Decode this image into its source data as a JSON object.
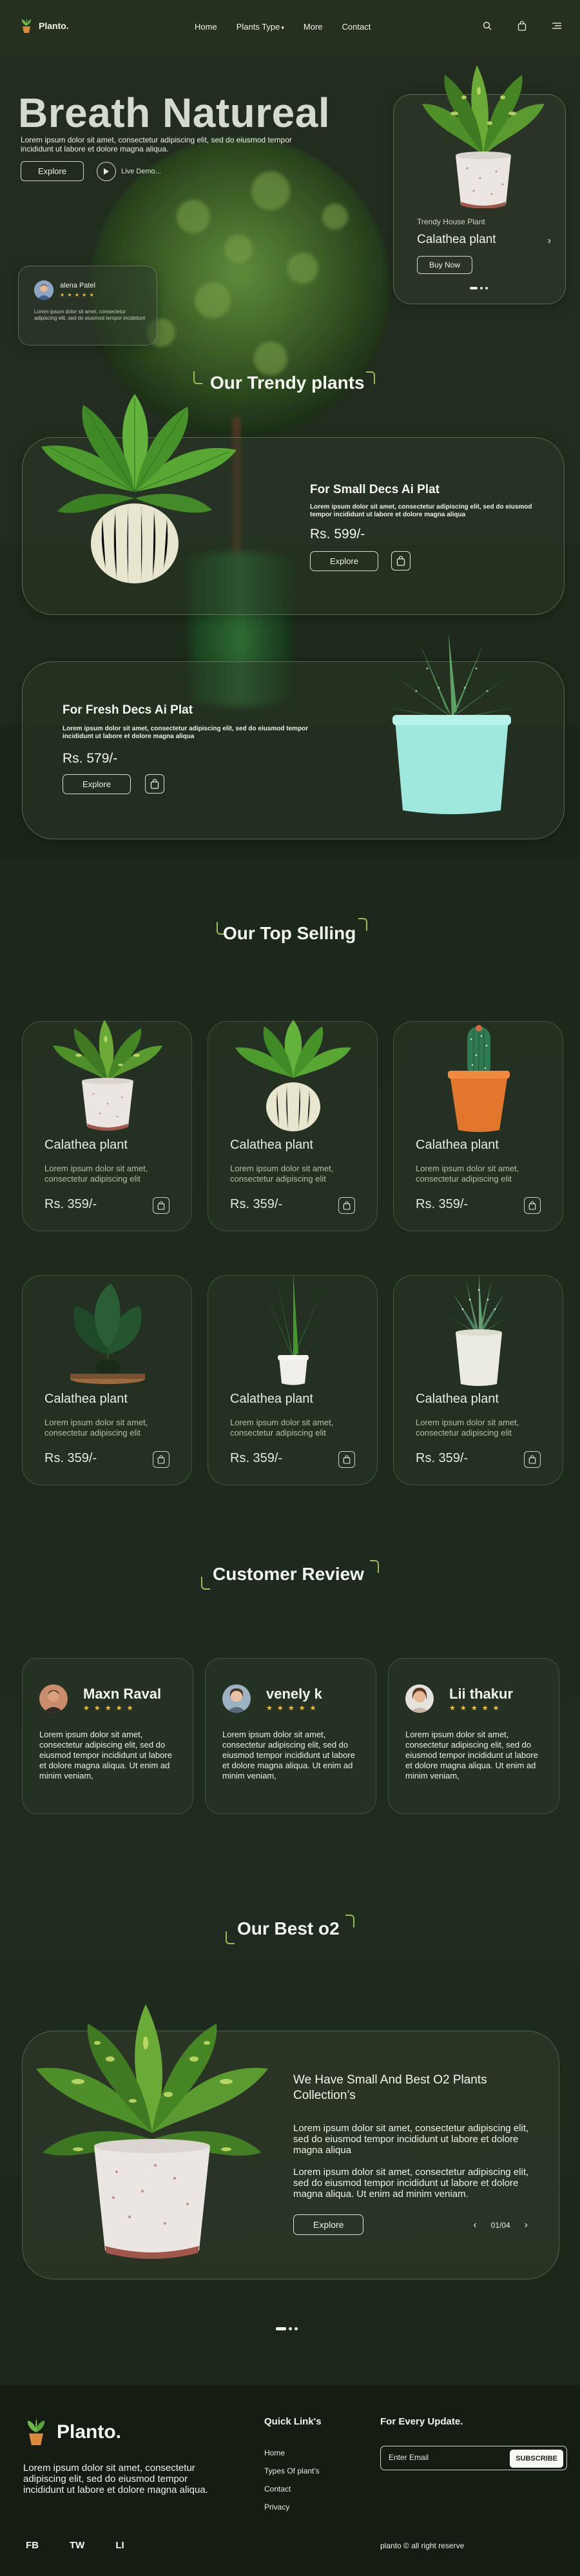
{
  "nav": {
    "logo": "Planto.",
    "links": [
      "Home",
      "Plants Type",
      "More",
      "Contact"
    ],
    "plants_type_caret": "▾"
  },
  "hero": {
    "title": "Breath Natureal",
    "description": "Lorem ipsum dolor sit amet, consectetur adipiscing elit, sed do eiusmod tempor incididunt ut labore et dolore magna aliqua.",
    "explore_label": "Explore",
    "live_demo_label": "Live Demo..."
  },
  "mini_review": {
    "name": "alena Patel",
    "stars": "★ ★ ★ ★ ★",
    "text": "Lorem ipsum dolor sit amet, consectetur adipiscing elit, sed do eiusmod tempor incididunt"
  },
  "trend_card": {
    "label": "Trendy House Plant",
    "name": "Calathea plant",
    "buy_label": "Buy Now"
  },
  "trendy": {
    "title": "Our Trendy plants",
    "cards": [
      {
        "heading": "For Small Decs Ai Plat",
        "text": "Lorem ipsum dolor sit amet, consectetur adipiscing elit, sed do eiusmod tempor incididunt ut labore et dolore magna aliqua",
        "price": "Rs. 599/-",
        "explore_label": "Explore"
      },
      {
        "heading": "For Fresh Decs Ai Plat",
        "text": "Lorem ipsum dolor sit amet, consectetur adipiscing elit, sed do eiusmod tempor incididunt ut labore et dolore magna aliqua",
        "price": "Rs. 579/-",
        "explore_label": "Explore"
      }
    ]
  },
  "top_selling": {
    "title": "Our Top Selling",
    "products": [
      {
        "name": "Calathea plant",
        "desc": "Lorem ipsum dolor sit amet, consectetur adipiscing elit",
        "price": "Rs. 359/-"
      },
      {
        "name": "Calathea plant",
        "desc": "Lorem ipsum dolor sit amet, consectetur adipiscing elit",
        "price": "Rs. 359/-"
      },
      {
        "name": "Calathea plant",
        "desc": "Lorem ipsum dolor sit amet, consectetur adipiscing elit",
        "price": "Rs. 359/-"
      },
      {
        "name": "Calathea plant",
        "desc": "Lorem ipsum dolor sit amet, consectetur adipiscing elit",
        "price": "Rs. 359/-"
      },
      {
        "name": "Calathea plant",
        "desc": "Lorem ipsum dolor sit amet, consectetur adipiscing elit",
        "price": "Rs. 359/-"
      },
      {
        "name": "Calathea plant",
        "desc": "Lorem ipsum dolor sit amet, consectetur adipiscing elit",
        "price": "Rs. 359/-"
      }
    ]
  },
  "reviews": {
    "title": "Customer Review",
    "items": [
      {
        "name": "Maxn Raval",
        "stars": "★ ★ ★ ★ ★",
        "text": "Lorem ipsum dolor sit amet, consectetur adipiscing elit, sed do eiusmod tempor incididunt ut labore et dolore magna aliqua. Ut enim ad minim veniam,"
      },
      {
        "name": "venely k",
        "stars": "★ ★ ★ ★ ★",
        "text": "Lorem ipsum dolor sit amet, consectetur adipiscing elit, sed do eiusmod tempor incididunt ut labore et dolore magna aliqua. Ut enim ad minim veniam,"
      },
      {
        "name": "Lii thakur",
        "stars": "★ ★ ★ ★ ★",
        "text": "Lorem ipsum dolor sit amet, consectetur adipiscing elit, sed do eiusmod tempor incididunt ut labore et dolore magna aliqua. Ut enim ad minim veniam,"
      }
    ]
  },
  "best_o2": {
    "title": "Our Best o2",
    "heading": "We Have Small And Best O2 Plants Collection’s",
    "para1": "Lorem ipsum dolor sit amet, consectetur adipiscing elit, sed do eiusmod tempor incididunt ut labore et dolore magna aliqua",
    "para2": "Lorem ipsum dolor sit amet, consectetur adipiscing elit, sed do eiusmod tempor incididunt ut labore et dolore magna aliqua. Ut enim ad minim veniam.",
    "explore_label": "Explore",
    "prev": "‹",
    "page": "01/04",
    "next": "›"
  },
  "footer": {
    "logo": "Planto.",
    "description": "Lorem ipsum dolor sit amet, consectetur adipiscing elit, sed do eiusmod tempor incididunt ut labore et dolore magna aliqua.",
    "quick_links_title": "Quick Link's",
    "quick_links": [
      "Home",
      "Types Of plant's",
      "Contact",
      "Privacy"
    ],
    "update_title": "For Every Update.",
    "email_placeholder": "Enter Email",
    "subscribe_label": "SUBSCRIBE",
    "social": [
      "FB",
      "TW",
      "LI"
    ],
    "copyright": "planto © all right reserve"
  },
  "colors": {
    "background": "#1f2a1d",
    "accent": "#9fbb56",
    "star": "#f3c33b",
    "card_border": "#a0b496"
  }
}
